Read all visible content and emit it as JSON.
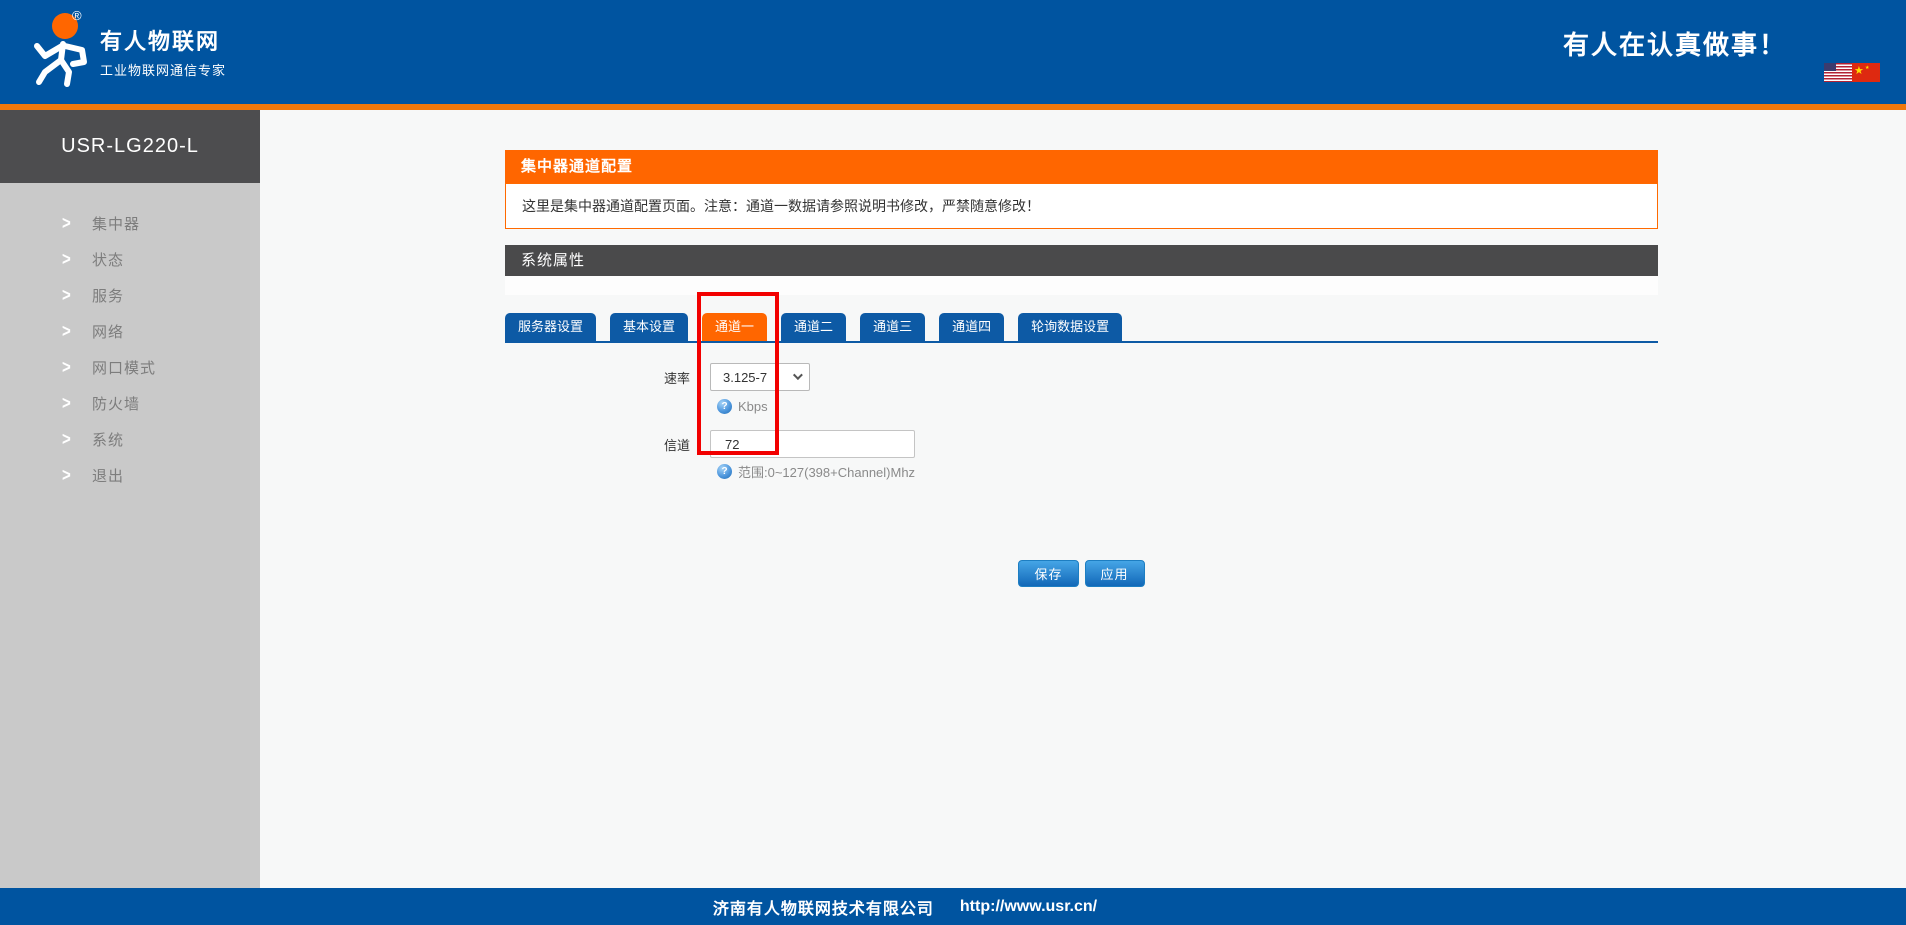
{
  "colors": {
    "header_blue": "#0054a0",
    "stripe_orange": "#f0780c",
    "accent_orange": "#ff6600",
    "tab_blue": "#0d5aa5",
    "section_gray": "#4a4a4b",
    "sidebar_gray": "#c9c9c9",
    "annotation_red": "#f20000"
  },
  "header": {
    "brand": "有人物联网",
    "reg_mark": "®",
    "tagline": "工业物联网通信专家",
    "slogan": "有人在认真做事！"
  },
  "sidebar": {
    "device_model": "USR-LG220-L",
    "items": [
      "集中器",
      "状态",
      "服务",
      "网络",
      "网口模式",
      "防火墙",
      "系统",
      "退出"
    ]
  },
  "icons": {
    "chevron_right": ">",
    "help": "?",
    "star_large": "★",
    "star_small": "★"
  },
  "main": {
    "page_title": "集中器通道配置",
    "note": "这里是集中器通道配置页面。注意：通道一数据请参照说明书修改，严禁随意修改！",
    "section_title": "系统属性",
    "tabs": [
      "服务器设置",
      "基本设置",
      "通道一",
      "通道二",
      "通道三",
      "通道四",
      "轮询数据设置"
    ],
    "active_tab": "通道一",
    "form": {
      "rate_label": "速率",
      "rate_value": "3.125-7",
      "rate_unit_hint": "Kbps",
      "channel_label": "信道",
      "channel_value": "72",
      "channel_range_hint": "范围:0~127(398+Channel)Mhz"
    },
    "save_button": "保存",
    "apply_button": "应用"
  },
  "footer": {
    "company": "济南有人物联网技术有限公司",
    "url": "http://www.usr.cn/"
  }
}
